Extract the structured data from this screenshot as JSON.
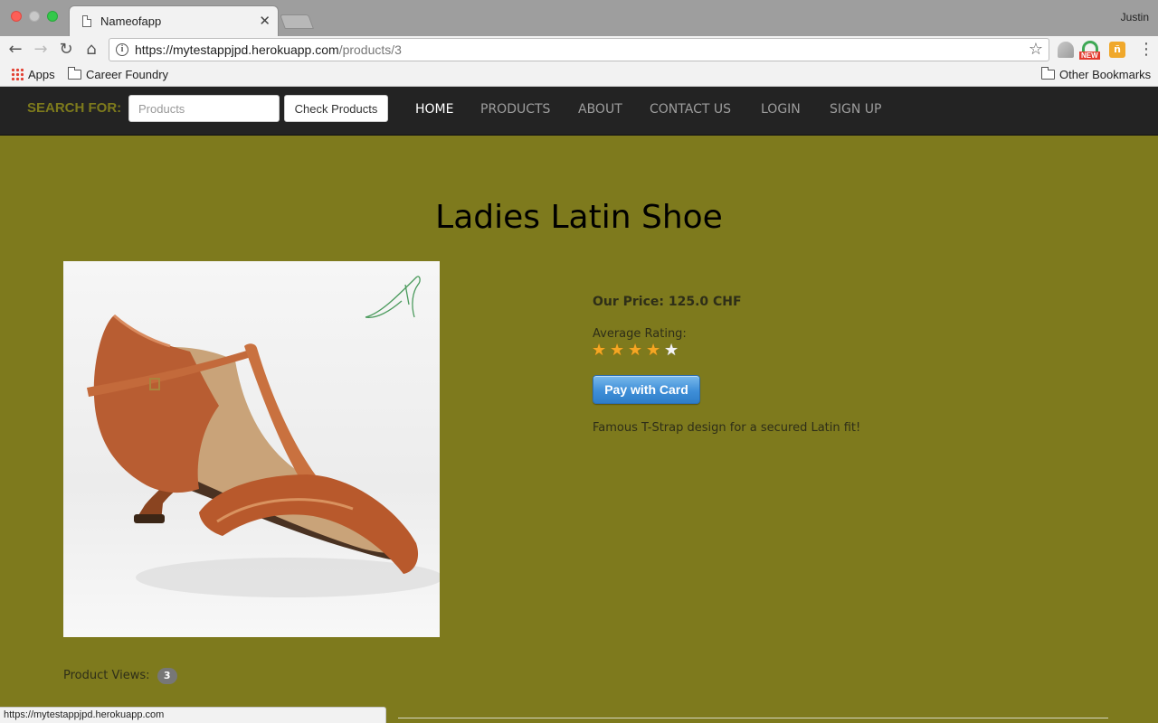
{
  "browser": {
    "tab_title": "Nameofapp",
    "profile_name": "Justin",
    "url_host": "https://mytestappjpd.herokuapp.com",
    "url_path": "/products/3",
    "bookmarks": {
      "apps": "Apps",
      "career": "Career Foundry",
      "other": "Other Bookmarks"
    },
    "extension_badge": "NEW",
    "status_url": "https://mytestappjpd.herokuapp.com"
  },
  "nav": {
    "search_label": "SEARCH FOR:",
    "search_placeholder": "Products",
    "search_button": "Check Products",
    "links": [
      "HOME",
      "PRODUCTS",
      "ABOUT",
      "CONTACT US",
      "LOGIN",
      "SIGN UP"
    ],
    "active_link": "HOME"
  },
  "product": {
    "title": "Ladies Latin Shoe",
    "price": "Our Price: 125.0 CHF",
    "rating_label": "Average Rating:",
    "rating": 4,
    "rating_max": 5,
    "pay_button": "Pay with Card",
    "description": "Famous T-Strap design for a secured Latin fit!",
    "views_label": "Product Views:",
    "views_count": "3"
  },
  "colors": {
    "page_background": "#7e7a1d",
    "navbar": "#232323",
    "search_label": "#7d7a1c",
    "star_filled": "#f5a623",
    "pay_button": "#3f8fd8"
  }
}
